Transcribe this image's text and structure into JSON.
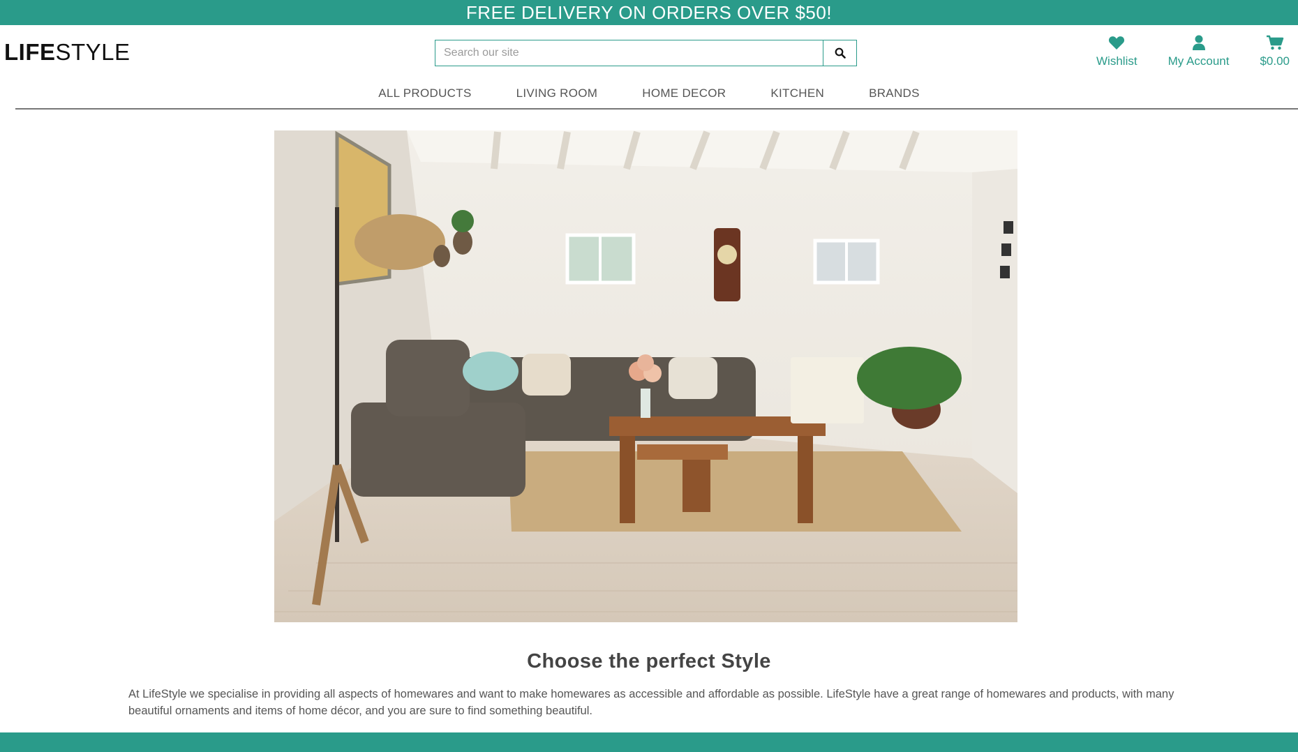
{
  "banner": {
    "text": "FREE DELIVERY ON ORDERS OVER $50!"
  },
  "logo": {
    "bold": "LIFE",
    "regular": "STYLE"
  },
  "search": {
    "placeholder": "Search our site",
    "icon": "search-icon"
  },
  "account_links": {
    "wishlist": {
      "label": "Wishlist",
      "icon": "heart-icon"
    },
    "account": {
      "label": "My Account",
      "icon": "user-icon"
    },
    "cart": {
      "label": "$0.00",
      "icon": "cart-icon"
    }
  },
  "nav": {
    "items": [
      {
        "label": "ALL PRODUCTS"
      },
      {
        "label": "LIVING ROOM"
      },
      {
        "label": "HOME DECOR"
      },
      {
        "label": "KITCHEN"
      },
      {
        "label": "BRANDS"
      }
    ]
  },
  "hero": {
    "description": "Living room with sofa, coffee table, floor lamp, clock and plants"
  },
  "content": {
    "heading": "Choose the perfect Style",
    "blurb": "At LifeStyle we specialise in providing all aspects of homewares and want to make homewares as accessible and affordable as possible. LifeStyle have a great range of homewares and products, with many beautiful ornaments and items of home décor, and you are sure to find something beautiful."
  },
  "colors": {
    "brand": "#2a9b8a"
  }
}
